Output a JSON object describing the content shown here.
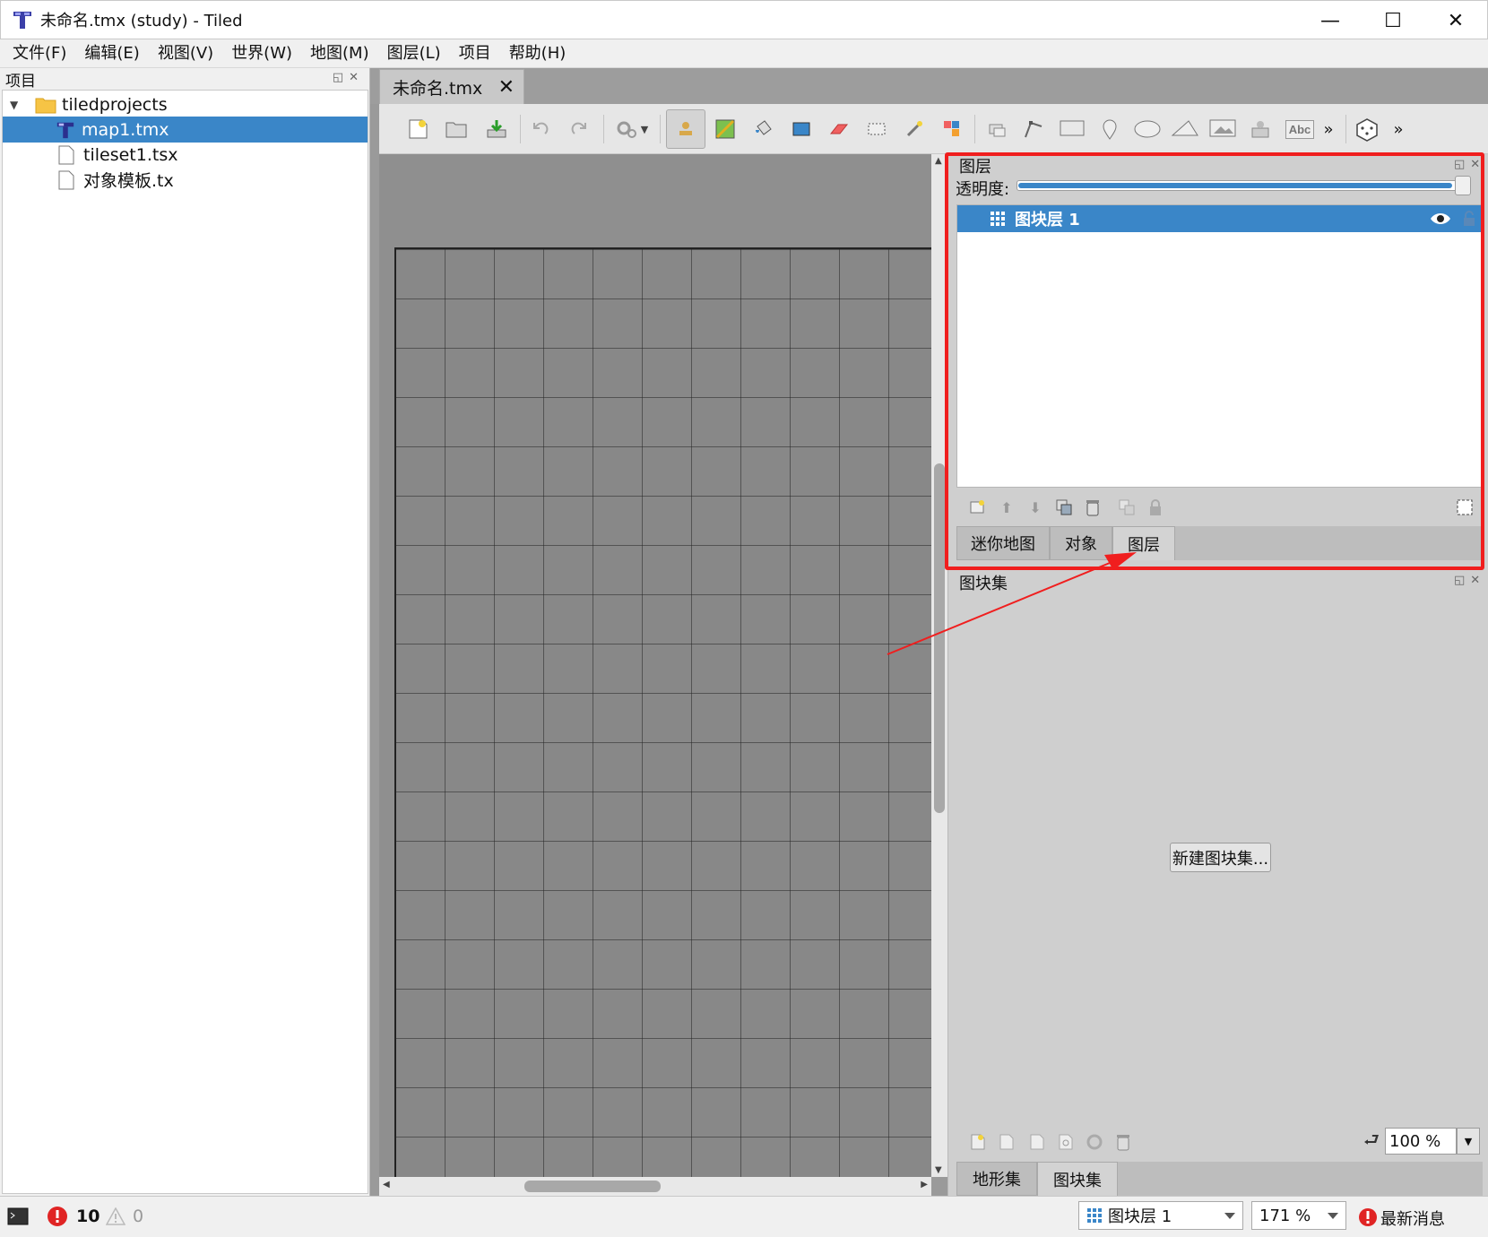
{
  "window": {
    "title": "未命名.tmx (study) - Tiled",
    "minimize_glyph": "—",
    "maximize_glyph": "☐",
    "close_glyph": "✕"
  },
  "menu": [
    "文件(F)",
    "编辑(E)",
    "视图(V)",
    "世界(W)",
    "地图(M)",
    "图层(L)",
    "项目",
    "帮助(H)"
  ],
  "project_panel": {
    "title": "项目",
    "tree": [
      {
        "label": "tiledprojects",
        "icon": "folder-icon",
        "expanded": true
      },
      {
        "label": "map1.tmx",
        "icon": "tiled-map-icon",
        "selected": true
      },
      {
        "label": "tileset1.tsx",
        "icon": "file-icon"
      },
      {
        "label": "对象模板.tx",
        "icon": "file-icon"
      }
    ]
  },
  "document_tab": {
    "label": "未命名.tmx",
    "close": "✕"
  },
  "toolbar": {
    "overflow_glyph": "»"
  },
  "layers_panel": {
    "title": "图层",
    "opacity_label": "透明度:",
    "opacity": 1.0,
    "layers": [
      {
        "name": "图块层 1",
        "visible": true,
        "selected": true
      }
    ],
    "tabs": [
      "迷你地图",
      "对象",
      "图层"
    ],
    "active_tab": "图层"
  },
  "tilesets_panel": {
    "title": "图块集",
    "new_tileset_button": "新建图块集...",
    "zoom": "100 %",
    "tabs": [
      "地形集",
      "图块集"
    ],
    "active_tab": "图块集"
  },
  "status_bar": {
    "error_count": "10",
    "warning_count": "0",
    "current_layer": "图块层 1",
    "zoom": "171 %",
    "news": "最新消息"
  },
  "colors": {
    "accent": "#3a86c8",
    "highlight": "#f01e1e"
  }
}
